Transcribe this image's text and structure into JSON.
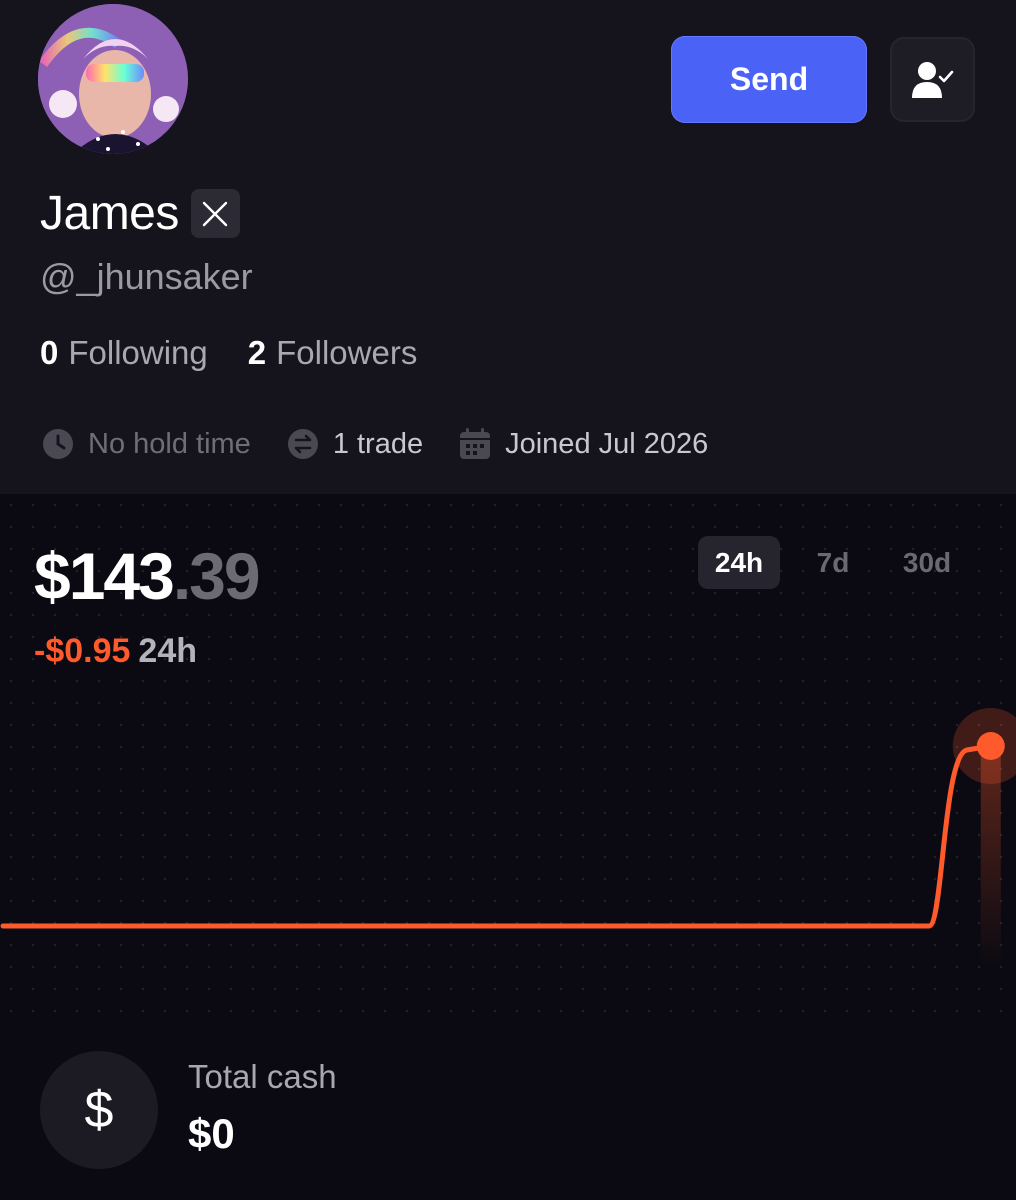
{
  "profile": {
    "name": "James",
    "handle": "@_jhunsaker",
    "following_count": "0",
    "following_label": "Following",
    "followers_count": "2",
    "followers_label": "Followers",
    "meta": {
      "hold_time": "No hold time",
      "trades": "1 trade",
      "joined": "Joined Jul 2026"
    }
  },
  "actions": {
    "send_label": "Send",
    "follow_icon": "user-check-icon"
  },
  "portfolio": {
    "balance_whole": "$143",
    "balance_cents": ".39",
    "change": "-$0.95",
    "change_period": "24h",
    "ranges": [
      "24h",
      "7d",
      "30d"
    ],
    "active_range": "24h"
  },
  "chart_data": {
    "type": "line",
    "x": [
      0,
      0.9,
      0.92,
      0.94,
      0.96
    ],
    "y": [
      142.44,
      142.44,
      142.6,
      143.2,
      143.39
    ],
    "color": "#ff5a2c"
  },
  "cash": {
    "label": "Total cash",
    "value": "$0",
    "icon": "dollar-icon"
  }
}
